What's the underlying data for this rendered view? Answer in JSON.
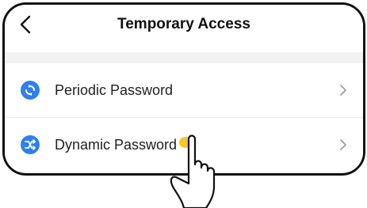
{
  "header": {
    "title": "Temporary Access",
    "back_icon": "chevron-left-icon"
  },
  "list": {
    "items": [
      {
        "label": "Periodic Password",
        "icon": "refresh-icon",
        "icon_color": "#2f80ed"
      },
      {
        "label": "Dynamic Password",
        "icon": "shuffle-icon",
        "icon_color": "#2f80ed"
      }
    ],
    "chevron_icon": "chevron-right-icon"
  },
  "overlay": {
    "pointer_icon": "hand-pointer-icon",
    "tap_color": "#f2c200"
  }
}
